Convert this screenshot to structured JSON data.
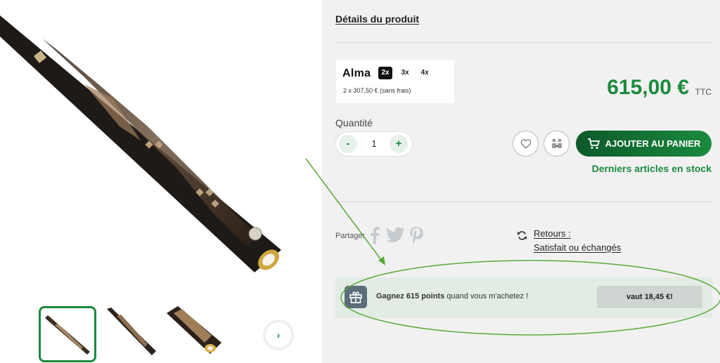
{
  "gallery": {
    "next_icon": "chevron-right-icon",
    "next_glyph": "›",
    "thumbnails": [
      "thumb-1",
      "thumb-2",
      "thumb-3"
    ],
    "active_index": 0
  },
  "product": {
    "details_link": "Détails du produit",
    "price": "615,00 €",
    "price_suffix": "TTC",
    "stock_status": "Derniers articles en stock"
  },
  "alma": {
    "logo": "Alma",
    "options": [
      "2x",
      "3x",
      "4x"
    ],
    "selected": "2x",
    "installment_text": "2 x 307,50 € (sans frais)"
  },
  "quantity": {
    "label": "Quantité",
    "value": "1",
    "minus": "-",
    "plus": "+"
  },
  "actions": {
    "add_to_cart": "AJOUTER AU PANIER",
    "wishlist_icon": "heart-icon",
    "compare_icon": "compare-icon"
  },
  "share": {
    "label": "Partager",
    "networks": [
      "facebook",
      "twitter",
      "pinterest"
    ]
  },
  "returns": {
    "line1": "Retours :",
    "line2": "Satisfait ou échangés"
  },
  "loyalty": {
    "text_bold": "Gagnez 615 points",
    "text_rest": " quand vous m'achetez !",
    "worth_button": "vaut 18,45 €!"
  },
  "colors": {
    "accent": "#1b8a3e",
    "annotation": "#5aaa3a",
    "panel_bg": "#f1f1f1"
  }
}
